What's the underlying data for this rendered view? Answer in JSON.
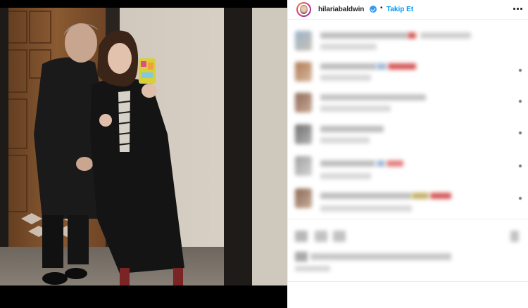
{
  "post": {
    "username": "hilariabaldwin",
    "follow_label": "Takip Et",
    "separator": "•"
  },
  "icons": {
    "verified": "verified-badge-icon",
    "more": "more-options-icon"
  },
  "colors": {
    "follow_blue": "#0095f6",
    "verified_blue": "#3897f0",
    "text": "#262626"
  }
}
